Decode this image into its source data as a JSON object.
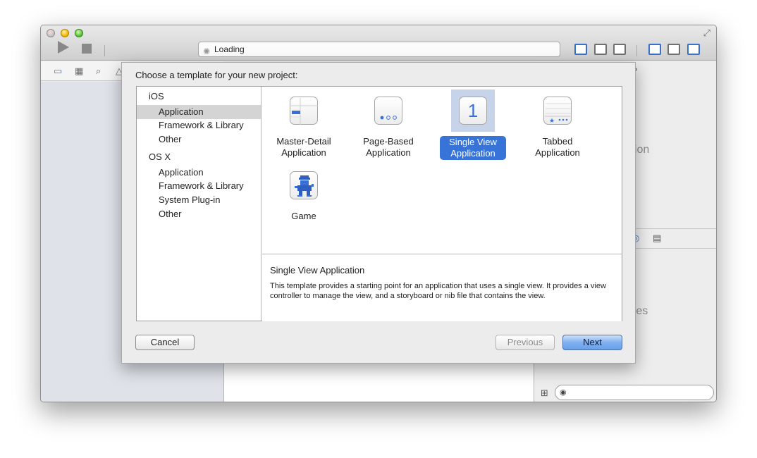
{
  "toolbar": {
    "activity_text": "Loading"
  },
  "ghost_text": {
    "selection": "lection",
    "matches": "tches"
  },
  "sheet": {
    "title": "Choose a template for your new project:",
    "sidebar": {
      "groups": [
        {
          "header": "iOS",
          "items": [
            "Application",
            "Framework & Library",
            "Other"
          ]
        },
        {
          "header": "OS X",
          "items": [
            "Application",
            "Framework & Library",
            "System Plug-in",
            "Other"
          ]
        }
      ],
      "selected": "iOS / Application"
    },
    "templates": [
      {
        "label_line1": "Master-Detail",
        "label_line2": "Application",
        "icon": "master-detail-icon"
      },
      {
        "label_line1": "Page-Based",
        "label_line2": "Application",
        "icon": "page-based-icon"
      },
      {
        "label_line1": "Single View",
        "label_line2": "Application",
        "icon": "single-view-icon",
        "icon_text": "1"
      },
      {
        "label_line1": "Tabbed",
        "label_line2": "Application",
        "icon": "tabbed-icon"
      },
      {
        "label_line1": "Game",
        "label_line2": "",
        "icon": "game-icon"
      }
    ],
    "selected_template": "Single View Application",
    "description": {
      "title": "Single View Application",
      "body": "This template provides a starting point for an application that uses a single view. It provides a view controller to manage the view, and a storyboard or nib file that contains the view."
    },
    "buttons": {
      "cancel": "Cancel",
      "previous": "Previous",
      "next": "Next"
    }
  },
  "colors": {
    "accent": "#3874d8",
    "selection_bg": "#c6d3e8",
    "primary_button": "#7fb0ef"
  }
}
